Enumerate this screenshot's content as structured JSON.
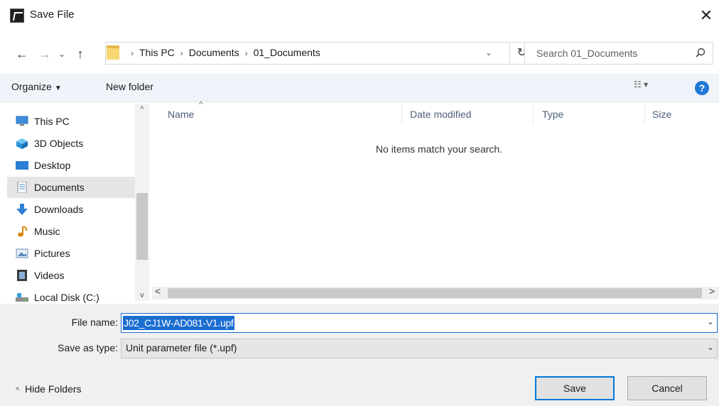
{
  "window": {
    "title": "Save File",
    "close_glyph": "✕"
  },
  "nav": {
    "back_glyph": "←",
    "forward_glyph": "→",
    "recent_glyph": "⌄",
    "up_glyph": "↑",
    "breadcrumbs": [
      "This PC",
      "Documents",
      "01_Documents"
    ],
    "separator": "›",
    "dropdown_glyph": "⌄",
    "refresh_glyph": "↻"
  },
  "search": {
    "placeholder": "Search 01_Documents"
  },
  "toolbar": {
    "organize_label": "Organize",
    "organize_caret": "▼",
    "new_folder_label": "New folder",
    "view_glyph": "☷ ▾",
    "help_glyph": "?"
  },
  "sidebar": {
    "items": [
      {
        "label": "This PC",
        "icon": "computer-icon"
      },
      {
        "label": "3D Objects",
        "icon": "cube-icon"
      },
      {
        "label": "Desktop",
        "icon": "desktop-icon"
      },
      {
        "label": "Documents",
        "icon": "document-icon",
        "selected": true
      },
      {
        "label": "Downloads",
        "icon": "download-arrow-icon"
      },
      {
        "label": "Music",
        "icon": "music-note-icon"
      },
      {
        "label": "Pictures",
        "icon": "pictures-icon"
      },
      {
        "label": "Videos",
        "icon": "film-icon"
      },
      {
        "label": "Local Disk (C:)",
        "icon": "drive-icon"
      }
    ],
    "scroll_up_glyph": "^",
    "scroll_down_glyph": "v"
  },
  "file_list": {
    "columns": [
      "Name",
      "Date modified",
      "Type",
      "Size"
    ],
    "sort_glyph": "^",
    "empty_message": "No items match your search.",
    "scroll_left_glyph": "<",
    "scroll_right_glyph": ">"
  },
  "form": {
    "file_name_label": "File name:",
    "file_name_value": "J02_CJ1W-AD081-V1.upf",
    "save_type_label": "Save as type:",
    "save_type_value": "Unit parameter file (*.upf)",
    "dropdown_glyph": "⌄"
  },
  "footer": {
    "hide_folders_chevron": "^",
    "hide_folders_label": "Hide Folders",
    "save_label": "Save",
    "cancel_label": "Cancel"
  },
  "colors": {
    "accent": "#0078d7",
    "selection": "#1a6dd1",
    "toolbar_bg": "#f0f3f9",
    "form_bg": "#f0f0f0"
  }
}
